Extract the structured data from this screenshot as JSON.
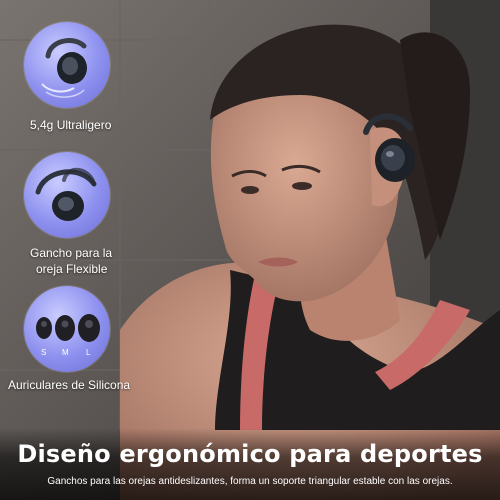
{
  "features": [
    {
      "label": "5,4g Ultraligero",
      "icon": "earbud-with-hook-icon"
    },
    {
      "label_line1": "Gancho para la",
      "label_line2": "oreja Flexible",
      "icon": "flexible-ear-hook-icon"
    },
    {
      "label": "Auriculares de Silicona",
      "icon": "silicone-ear-tips-icon",
      "sizes": [
        "S",
        "M",
        "L"
      ]
    }
  ],
  "headline": "Diseño ergonómico para deportes",
  "subline": "Ganchos para las orejas antideslizantes, forma un soporte triangular estable con las orejas.",
  "colors": {
    "feature_circle": "#8d90ee",
    "tank_top": "#c76a68",
    "background": "#5f5a57"
  }
}
